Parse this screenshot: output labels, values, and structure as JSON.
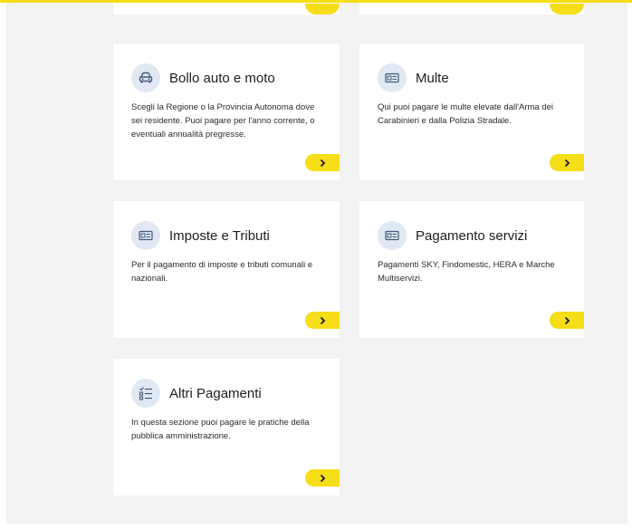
{
  "colors": {
    "accent": "#f5dd17",
    "icon_bg": "#dfe8f3",
    "icon_fg": "#43577a",
    "background": "#f2f2f2",
    "card": "#ffffff"
  },
  "cards": [
    {
      "title": "Bollo auto e moto",
      "description": "Scegli la Regione o la Provincia Autonoma dove sei residente. Puoi pagare per l'anno corrente, o eventuali annualità pregresse.",
      "icon": "car-icon",
      "action_icon": "chevron-right-icon"
    },
    {
      "title": "Multe",
      "description": "Qui puoi pagare le multe elevate dall'Arma dei Carabinieri e dalla Polizia Stradale.",
      "icon": "id-card-icon",
      "action_icon": "chevron-right-icon"
    },
    {
      "title": "Imposte e Tributi",
      "description": "Per il pagamento di imposte e tributi comunali e nazionali.",
      "icon": "id-card-icon",
      "action_icon": "chevron-right-icon"
    },
    {
      "title": "Pagamento servizi",
      "description": "Pagamenti SKY, Findomestic, HERA e Marche Multiservizi.",
      "icon": "id-card-icon",
      "action_icon": "chevron-right-icon"
    },
    {
      "title": "Altri Pagamenti",
      "description": "In questa sezione puoi pagare le pratiche della pubblica amministrazione.",
      "icon": "checklist-icon",
      "action_icon": "chevron-right-icon"
    }
  ]
}
